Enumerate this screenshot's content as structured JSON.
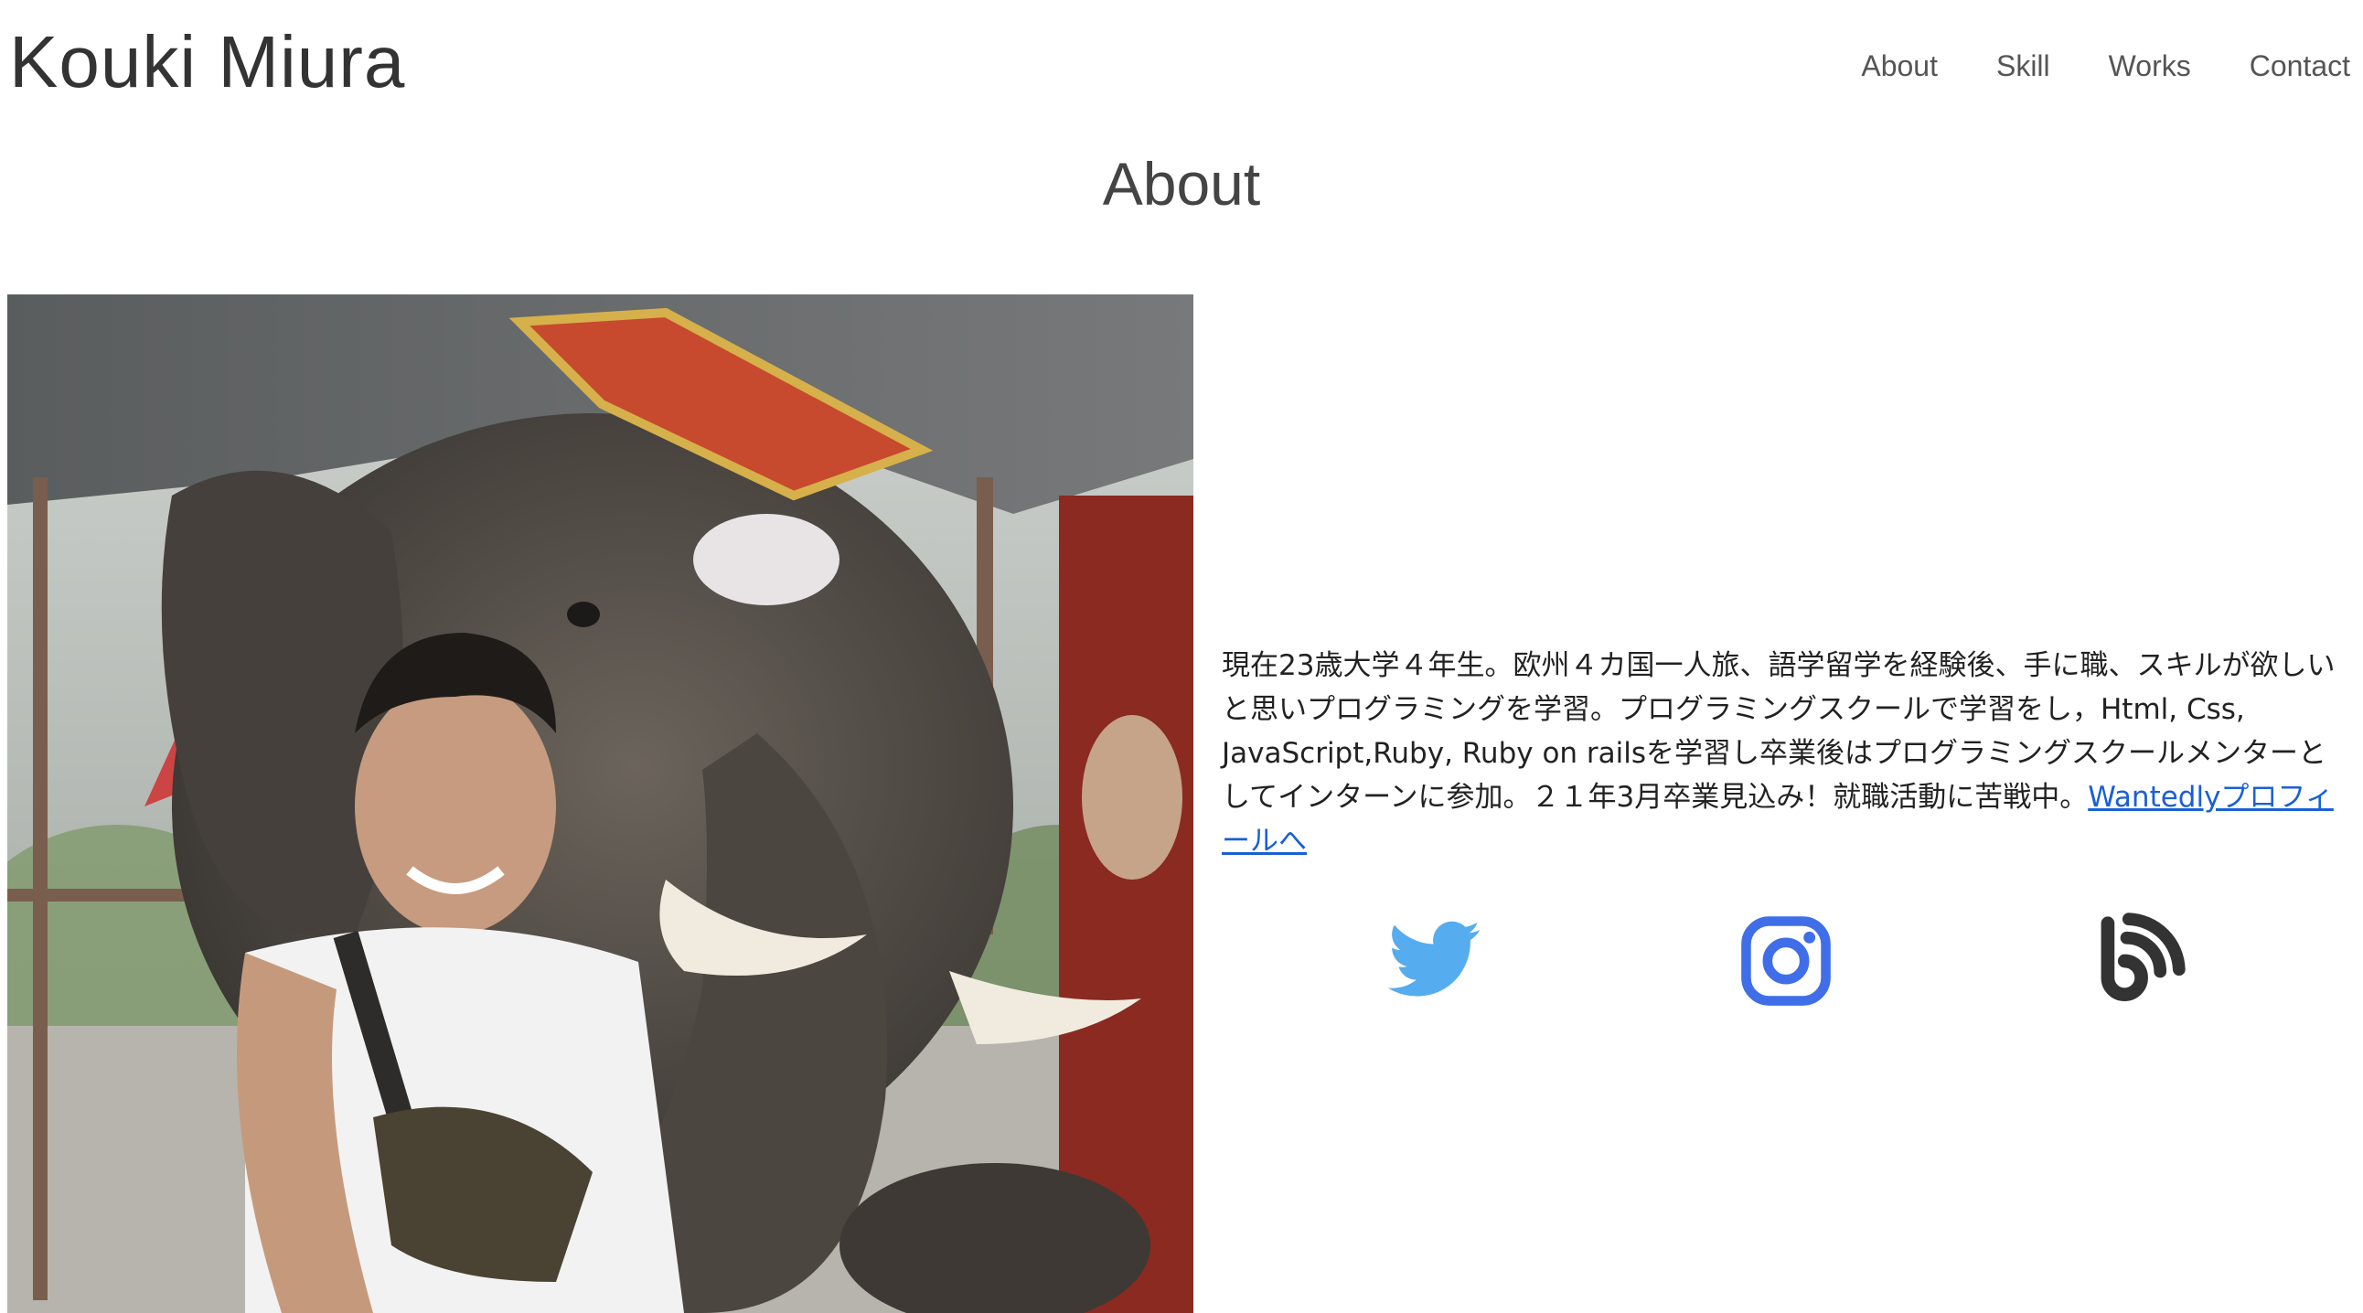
{
  "header": {
    "logo": "Kouki Miura",
    "nav": [
      {
        "label": "About"
      },
      {
        "label": "Skill"
      },
      {
        "label": "Works"
      },
      {
        "label": "Contact"
      }
    ]
  },
  "about": {
    "title": "About",
    "bio_text": "現在23歳大学４年生。欧州４カ国一人旅、語学留学を経験後、手に職、スキルが欲しいと思いプログラミングを学習。プログラミングスクールで学習をし，Html, Css, JavaScript,Ruby, Ruby on railsを学習し卒業後はプログラミングスクールメンターとしてインターンに参加。２１年3月卒業見込み！就職活動に苦戦中。",
    "bio_link": "Wantedlyプロフィールへ",
    "photo_icon": "profile-photo-elephant"
  },
  "social": [
    {
      "name": "twitter-icon",
      "color": "#55acee"
    },
    {
      "name": "instagram-icon",
      "color": "#3f6ee8"
    },
    {
      "name": "blog-icon",
      "color": "#333333"
    }
  ]
}
